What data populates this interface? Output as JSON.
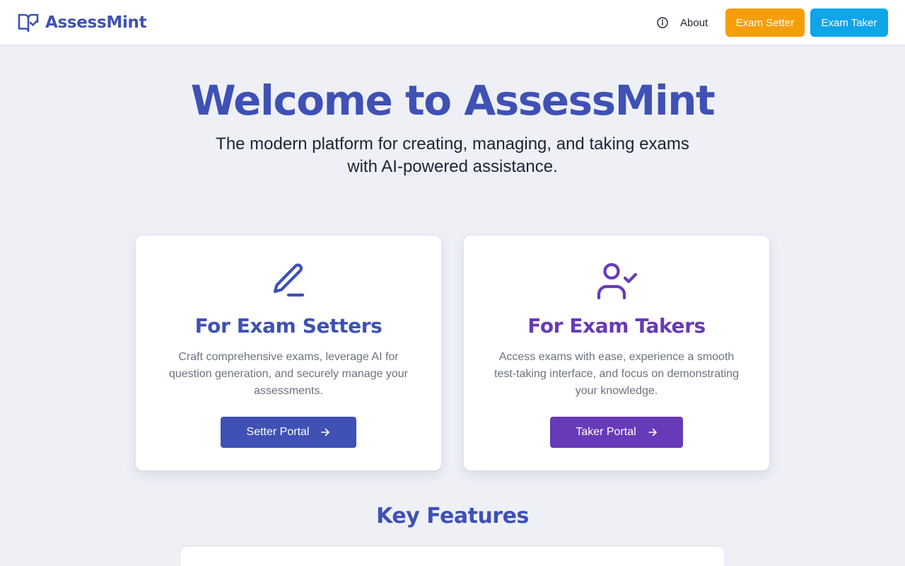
{
  "header": {
    "brand_name": "AssessMint",
    "about_label": "About",
    "exam_setter_label": "Exam Setter",
    "exam_taker_label": "Exam Taker"
  },
  "hero": {
    "title": "Welcome to AssessMint",
    "subtitle": "The modern platform for creating, managing, and taking exams with AI-powered assistance."
  },
  "cards": {
    "setter": {
      "icon": "pencil-line-icon",
      "title": "For Exam Setters",
      "description": "Craft comprehensive exams, leverage AI for question generation, and securely manage your assessments.",
      "button_label": "Setter Portal"
    },
    "taker": {
      "icon": "user-check-icon",
      "title": "For Exam Takers",
      "description": "Access exams with ease, experience a smooth test-taking interface, and focus on demonstrating your knowledge.",
      "button_label": "Taker Portal"
    }
  },
  "features": {
    "title": "Key Features"
  },
  "colors": {
    "primary": "#3f51b5",
    "secondary": "#673ab7",
    "setter_accent": "#f59e0b",
    "taker_accent": "#0ea5e9",
    "background": "#eef0f6"
  }
}
